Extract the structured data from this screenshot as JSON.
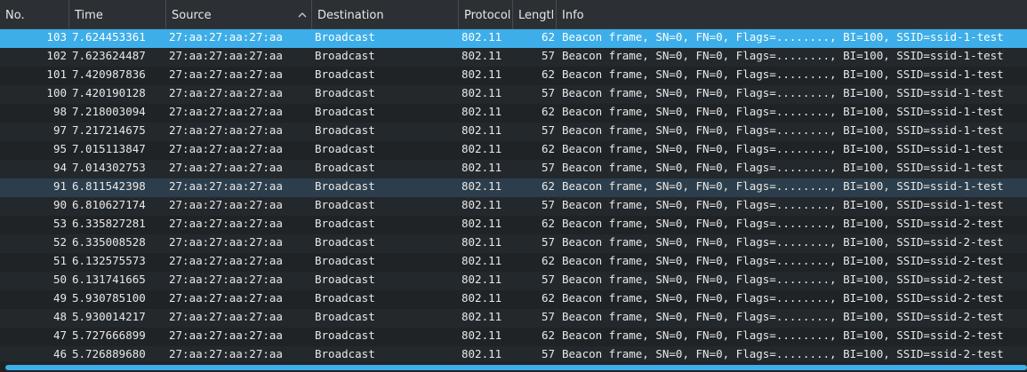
{
  "columns": {
    "no": "No.",
    "time": "Time",
    "source": "Source",
    "destination": "Destination",
    "protocol": "Protocol",
    "length": "Lengtl",
    "info": "Info"
  },
  "sort": {
    "column": "source",
    "direction": "ascending",
    "icon": "chevron-up-icon"
  },
  "colors": {
    "selected_row": "#3daee9",
    "focused_row": "#2c3e4c",
    "header_bg": "#2c3034",
    "list_bg": "#1f2326"
  },
  "rows": [
    {
      "no": "103",
      "time": "7.624453361",
      "source": "27:aa:27:aa:27:aa",
      "destination": "Broadcast",
      "protocol": "802.11",
      "length": "62",
      "info": "Beacon frame, SN=0, FN=0, Flags=........, BI=100, SSID=ssid-1-test"
    },
    {
      "no": "102",
      "time": "7.623624487",
      "source": "27:aa:27:aa:27:aa",
      "destination": "Broadcast",
      "protocol": "802.11",
      "length": "57",
      "info": "Beacon frame, SN=0, FN=0, Flags=........, BI=100, SSID=ssid-1-test"
    },
    {
      "no": "101",
      "time": "7.420987836",
      "source": "27:aa:27:aa:27:aa",
      "destination": "Broadcast",
      "protocol": "802.11",
      "length": "62",
      "info": "Beacon frame, SN=0, FN=0, Flags=........, BI=100, SSID=ssid-1-test"
    },
    {
      "no": "100",
      "time": "7.420190128",
      "source": "27:aa:27:aa:27:aa",
      "destination": "Broadcast",
      "protocol": "802.11",
      "length": "57",
      "info": "Beacon frame, SN=0, FN=0, Flags=........, BI=100, SSID=ssid-1-test"
    },
    {
      "no": "98",
      "time": "7.218003094",
      "source": "27:aa:27:aa:27:aa",
      "destination": "Broadcast",
      "protocol": "802.11",
      "length": "62",
      "info": "Beacon frame, SN=0, FN=0, Flags=........, BI=100, SSID=ssid-1-test"
    },
    {
      "no": "97",
      "time": "7.217214675",
      "source": "27:aa:27:aa:27:aa",
      "destination": "Broadcast",
      "protocol": "802.11",
      "length": "57",
      "info": "Beacon frame, SN=0, FN=0, Flags=........, BI=100, SSID=ssid-1-test"
    },
    {
      "no": "95",
      "time": "7.015113847",
      "source": "27:aa:27:aa:27:aa",
      "destination": "Broadcast",
      "protocol": "802.11",
      "length": "62",
      "info": "Beacon frame, SN=0, FN=0, Flags=........, BI=100, SSID=ssid-1-test"
    },
    {
      "no": "94",
      "time": "7.014302753",
      "source": "27:aa:27:aa:27:aa",
      "destination": "Broadcast",
      "protocol": "802.11",
      "length": "57",
      "info": "Beacon frame, SN=0, FN=0, Flags=........, BI=100, SSID=ssid-1-test"
    },
    {
      "no": "91",
      "time": "6.811542398",
      "source": "27:aa:27:aa:27:aa",
      "destination": "Broadcast",
      "protocol": "802.11",
      "length": "62",
      "info": "Beacon frame, SN=0, FN=0, Flags=........, BI=100, SSID=ssid-1-test"
    },
    {
      "no": "90",
      "time": "6.810627174",
      "source": "27:aa:27:aa:27:aa",
      "destination": "Broadcast",
      "protocol": "802.11",
      "length": "57",
      "info": "Beacon frame, SN=0, FN=0, Flags=........, BI=100, SSID=ssid-1-test"
    },
    {
      "no": "53",
      "time": "6.335827281",
      "source": "27:aa:27:aa:27:aa",
      "destination": "Broadcast",
      "protocol": "802.11",
      "length": "62",
      "info": "Beacon frame, SN=0, FN=0, Flags=........, BI=100, SSID=ssid-2-test"
    },
    {
      "no": "52",
      "time": "6.335008528",
      "source": "27:aa:27:aa:27:aa",
      "destination": "Broadcast",
      "protocol": "802.11",
      "length": "57",
      "info": "Beacon frame, SN=0, FN=0, Flags=........, BI=100, SSID=ssid-2-test"
    },
    {
      "no": "51",
      "time": "6.132575573",
      "source": "27:aa:27:aa:27:aa",
      "destination": "Broadcast",
      "protocol": "802.11",
      "length": "62",
      "info": "Beacon frame, SN=0, FN=0, Flags=........, BI=100, SSID=ssid-2-test"
    },
    {
      "no": "50",
      "time": "6.131741665",
      "source": "27:aa:27:aa:27:aa",
      "destination": "Broadcast",
      "protocol": "802.11",
      "length": "57",
      "info": "Beacon frame, SN=0, FN=0, Flags=........, BI=100, SSID=ssid-2-test"
    },
    {
      "no": "49",
      "time": "5.930785100",
      "source": "27:aa:27:aa:27:aa",
      "destination": "Broadcast",
      "protocol": "802.11",
      "length": "62",
      "info": "Beacon frame, SN=0, FN=0, Flags=........, BI=100, SSID=ssid-2-test"
    },
    {
      "no": "48",
      "time": "5.930014217",
      "source": "27:aa:27:aa:27:aa",
      "destination": "Broadcast",
      "protocol": "802.11",
      "length": "57",
      "info": "Beacon frame, SN=0, FN=0, Flags=........, BI=100, SSID=ssid-2-test"
    },
    {
      "no": "47",
      "time": "5.727666899",
      "source": "27:aa:27:aa:27:aa",
      "destination": "Broadcast",
      "protocol": "802.11",
      "length": "62",
      "info": "Beacon frame, SN=0, FN=0, Flags=........, BI=100, SSID=ssid-2-test"
    },
    {
      "no": "46",
      "time": "5.726889680",
      "source": "27:aa:27:aa:27:aa",
      "destination": "Broadcast",
      "protocol": "802.11",
      "length": "57",
      "info": "Beacon frame, SN=0, FN=0, Flags=........, BI=100, SSID=ssid-2-test"
    }
  ],
  "selected_index": 0,
  "focused_index": 8
}
